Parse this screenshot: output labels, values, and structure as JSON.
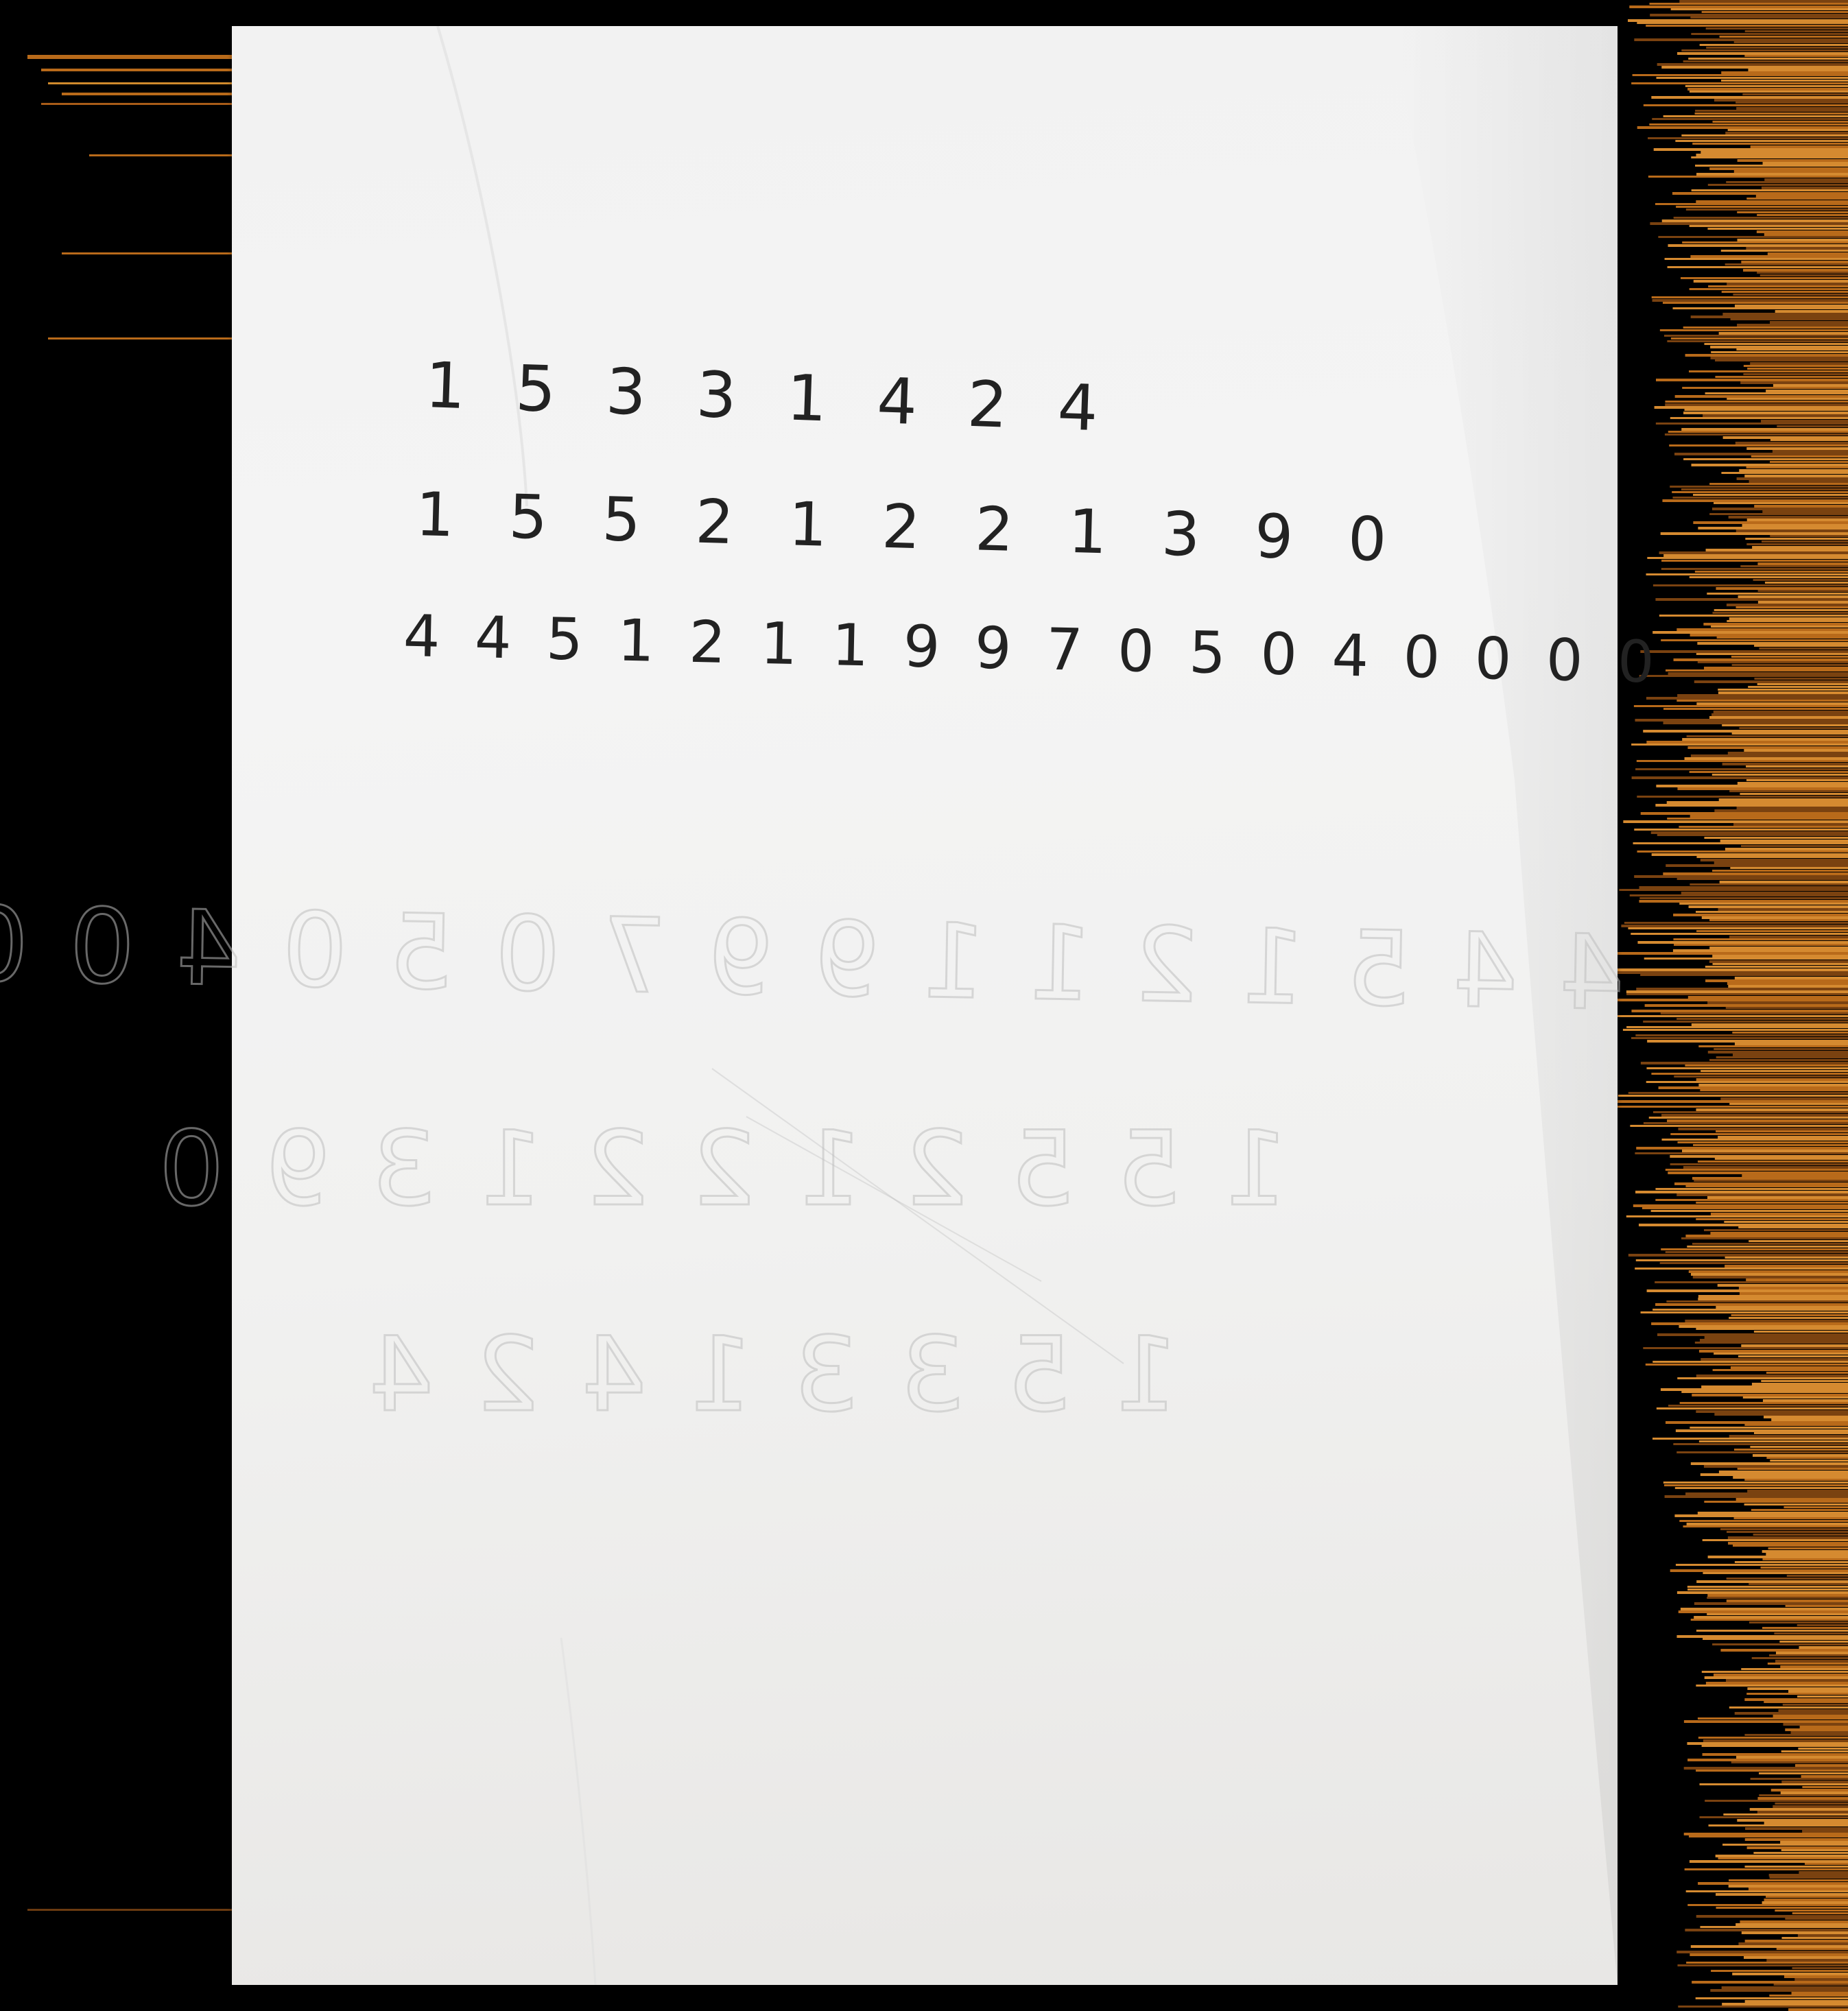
{
  "handwritten_rows": [
    "1 5 3 3 1 4 2 4",
    "1 5 5 2 1 2 2 1 3 9 0",
    "4 4 5 1 2 1 1 9 9 7 0 5 0 4 0 0 0 0"
  ],
  "colors": {
    "background": "#000000",
    "paper": "#f2f2f2",
    "ink": "#222222",
    "edge_streaks": "#c8761e"
  }
}
